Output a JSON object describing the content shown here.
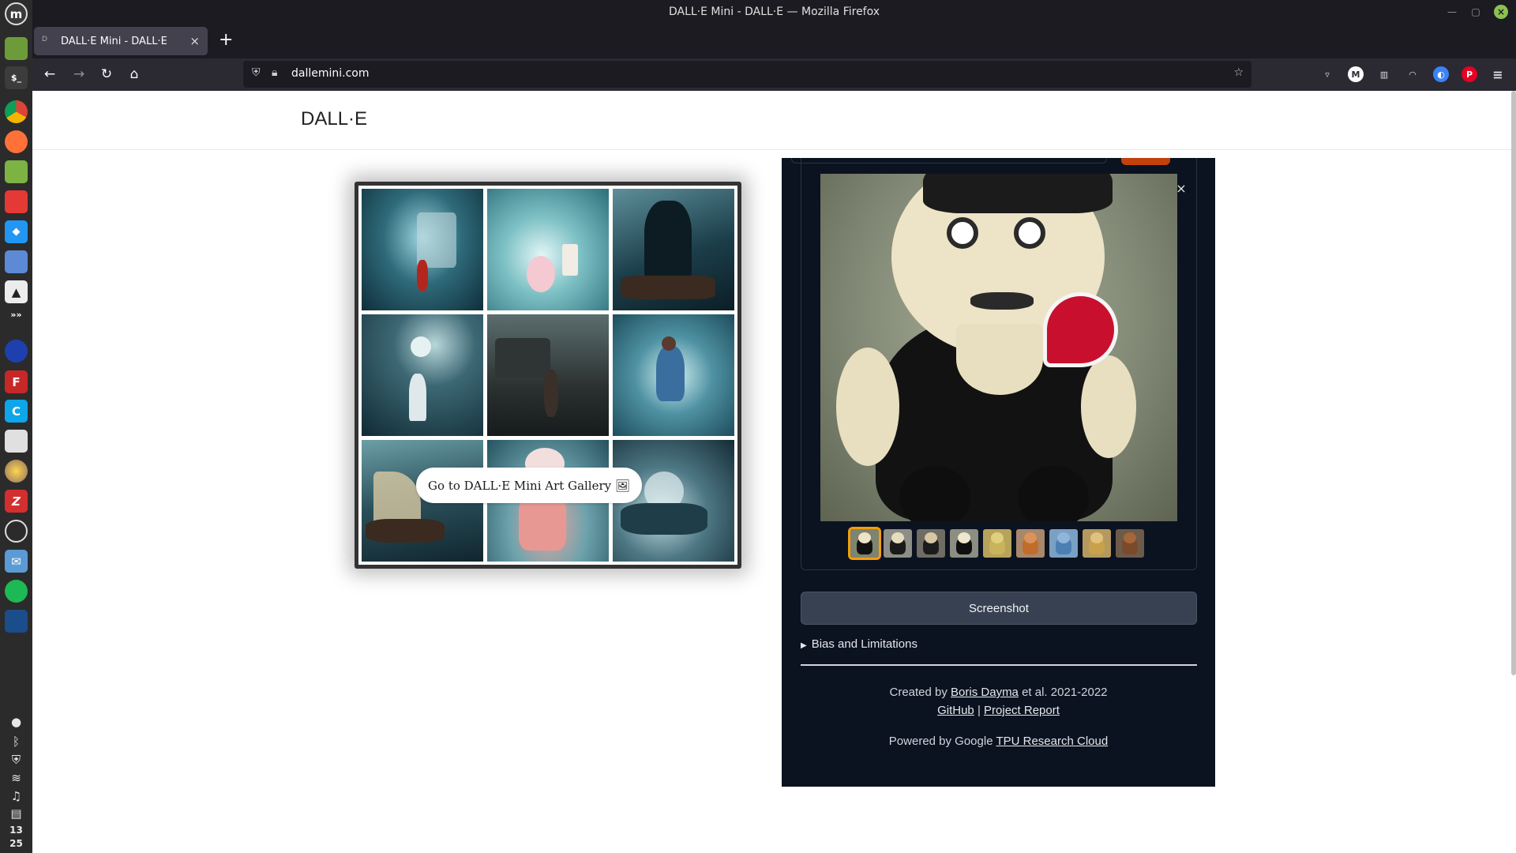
{
  "window": {
    "title": "DALL·E Mini - DALL·E — Mozilla Firefox"
  },
  "browser": {
    "tab_title": "DALL·E Mini - DALL·E",
    "tab_favicon": "D",
    "url": "dallemini.com"
  },
  "taskbar": {
    "clock_hour": "13",
    "clock_minute": "25"
  },
  "site": {
    "brand": "DALL·E"
  },
  "gallery": {
    "button_label": "Go to DALL·E Mini Art Gallery 🖼"
  },
  "results": {
    "close_label": "×",
    "thumbnail_count": 9,
    "selected_index": 0
  },
  "actions": {
    "screenshot_label": "Screenshot",
    "bias_label": "Bias and Limitations"
  },
  "footer": {
    "created_prefix": "Created by",
    "author": "Boris Dayma",
    "created_suffix": "et al. 2021-2022",
    "github": "GitHub",
    "separator": "|",
    "report": "Project Report",
    "powered_prefix": "Powered by Google",
    "powered_link": "TPU Research Cloud"
  },
  "colors": {
    "panel_bg": "#0b1220",
    "accent_orange": "#c2410c",
    "selected_thumb": "#f59e0b"
  }
}
